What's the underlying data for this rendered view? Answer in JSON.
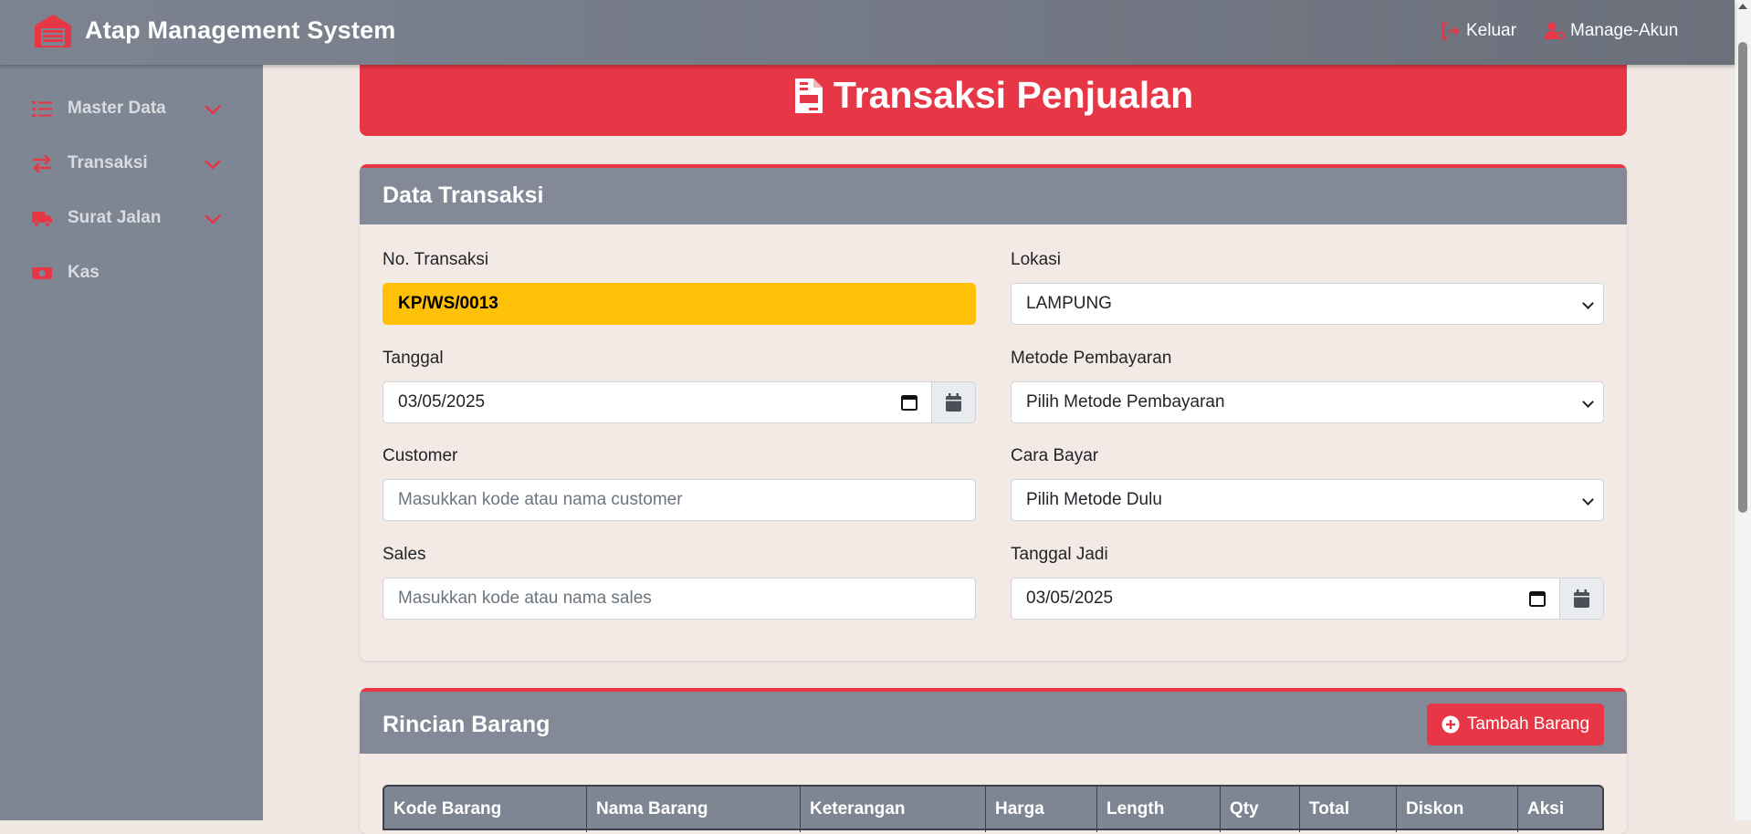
{
  "app": {
    "title": "Atap Management System"
  },
  "topnav": {
    "logout_label": "Keluar",
    "account_label": "Manage-Akun"
  },
  "sidebar": {
    "items": [
      {
        "label": "Master Data",
        "icon": "list-icon",
        "expandable": true
      },
      {
        "label": "Transaksi",
        "icon": "exchange-icon",
        "expandable": true
      },
      {
        "label": "Surat Jalan",
        "icon": "truck-icon",
        "expandable": true
      },
      {
        "label": "Kas",
        "icon": "money-icon",
        "expandable": false
      }
    ]
  },
  "page": {
    "title": "Transaksi Penjualan"
  },
  "transaction": {
    "header": "Data Transaksi",
    "no_transaksi": {
      "label": "No. Transaksi",
      "value": "KP/WS/0013"
    },
    "tanggal": {
      "label": "Tanggal",
      "value": "03/05/2025"
    },
    "customer": {
      "label": "Customer",
      "placeholder": "Masukkan kode atau nama customer"
    },
    "sales": {
      "label": "Sales",
      "placeholder": "Masukkan kode atau nama sales"
    },
    "lokasi": {
      "label": "Lokasi",
      "value": "LAMPUNG"
    },
    "metode": {
      "label": "Metode Pembayaran",
      "value": "Pilih Metode Pembayaran"
    },
    "cara_bayar": {
      "label": "Cara Bayar",
      "value": "Pilih Metode Dulu"
    },
    "tanggal_jadi": {
      "label": "Tanggal Jadi",
      "value": "03/05/2025"
    }
  },
  "items": {
    "header": "Rincian Barang",
    "add_button": "Tambah Barang",
    "columns": [
      "Kode Barang",
      "Nama Barang",
      "Keterangan",
      "Harga",
      "Length",
      "Qty",
      "Total",
      "Diskon",
      "Aksi"
    ]
  },
  "colors": {
    "accent": "#e73646",
    "sidebar": "#7f8693",
    "highlight": "#ffc107",
    "background": "#f1e8e3"
  }
}
